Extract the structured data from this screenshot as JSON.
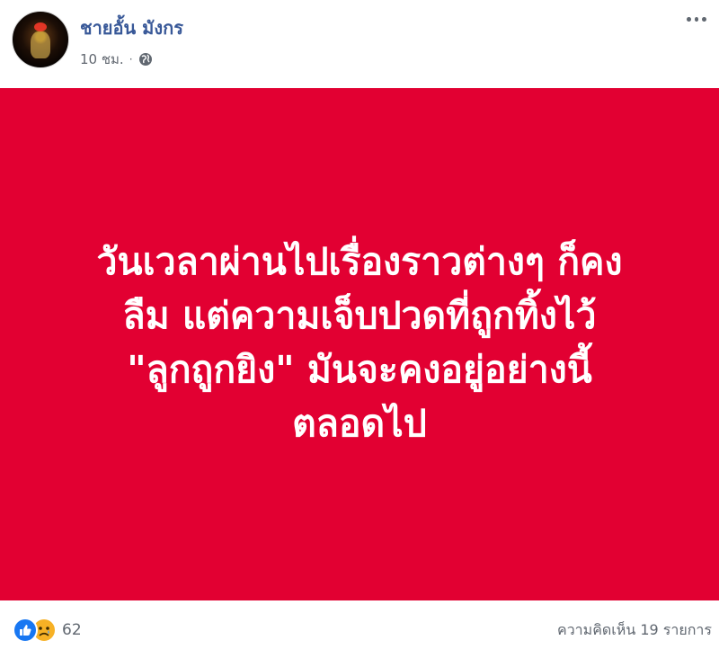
{
  "post": {
    "author_name": "ชายอั้น มังกร",
    "time_ago": "10 ชม.",
    "separator": "·",
    "privacy_icon": "globe-icon",
    "menu_icon": "more-options-icon",
    "card_background": "#e20032",
    "card_text_color": "#ffffff",
    "text_lines": [
      "วันเวลาผ่านไปเรื่องราวต่างๆ ก็คง",
      "ลืม แต่ความเจ็บปวดที่ถูกทิ้งไว้",
      "\"ลูกถูกยิง\" มันจะคงอยู่อย่างนี้",
      "ตลอดไป"
    ]
  },
  "footer": {
    "reaction_icons": [
      "like-icon",
      "sad-icon"
    ],
    "reaction_count": "62",
    "comments_label": "ความคิดเห็น 19 รายการ"
  }
}
